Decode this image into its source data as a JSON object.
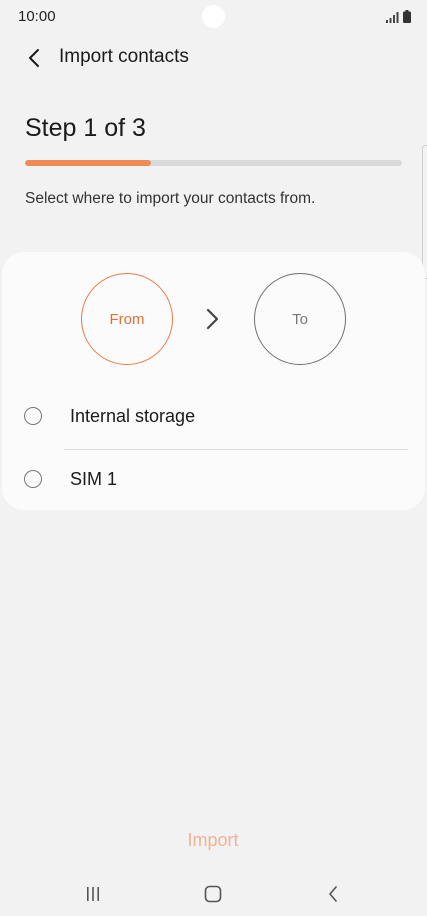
{
  "status_bar": {
    "time": "10:00",
    "icons": [
      "signal-icon",
      "battery-icon"
    ]
  },
  "header": {
    "back_icon": "chevron-left-icon",
    "title": "Import contacts"
  },
  "step": {
    "title": "Step 1 of 3",
    "progress_fraction": 0.333,
    "instruction": "Select where to import your contacts from."
  },
  "flow": {
    "from_label": "From",
    "to_label": "To",
    "arrow_icon": "chevron-right-icon"
  },
  "options": [
    {
      "label": "Internal storage",
      "selected": false
    },
    {
      "label": "SIM 1",
      "selected": false
    }
  ],
  "footer": {
    "import_label": "Import"
  },
  "nav": {
    "recents_icon": "recents-icon",
    "home_icon": "home-icon",
    "back_icon": "back-icon"
  },
  "colors": {
    "accent": "#ef8a55",
    "accent_disabled": "#f2b293",
    "background": "#f2f2f2",
    "card": "#fbfbfb"
  }
}
